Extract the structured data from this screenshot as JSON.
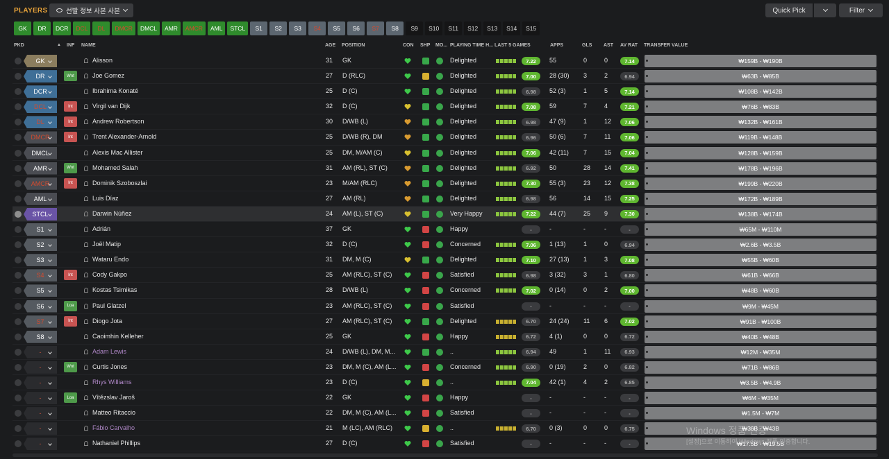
{
  "header": {
    "title": "PLAYERS",
    "view_label": "선발 정보 사본 사본",
    "quick_pick": "Quick Pick",
    "filter": "Filter"
  },
  "positions": [
    {
      "label": "GK",
      "style": "g"
    },
    {
      "label": "DR",
      "style": "g"
    },
    {
      "label": "DCR",
      "style": "g"
    },
    {
      "label": "DCL",
      "style": "r"
    },
    {
      "label": "DL",
      "style": "r"
    },
    {
      "label": "DMCR",
      "style": "r"
    },
    {
      "label": "DMCL",
      "style": "g"
    },
    {
      "label": "AMR",
      "style": "g"
    },
    {
      "label": "AMCR",
      "style": "r"
    },
    {
      "label": "AML",
      "style": "g"
    },
    {
      "label": "STCL",
      "style": "g"
    },
    {
      "label": "S1",
      "style": "b"
    },
    {
      "label": "S2",
      "style": "b"
    },
    {
      "label": "S3",
      "style": "b"
    },
    {
      "label": "S4",
      "style": "br"
    },
    {
      "label": "S5",
      "style": "b"
    },
    {
      "label": "S6",
      "style": "b"
    },
    {
      "label": "S7",
      "style": "br"
    },
    {
      "label": "S8",
      "style": "b"
    },
    {
      "label": "S9",
      "style": "d"
    },
    {
      "label": "S10",
      "style": "d"
    },
    {
      "label": "S11",
      "style": "d"
    },
    {
      "label": "S12",
      "style": "d"
    },
    {
      "label": "S13",
      "style": "d"
    },
    {
      "label": "S14",
      "style": "d"
    },
    {
      "label": "S15",
      "style": "d"
    }
  ],
  "columns": {
    "pkd": "PKD",
    "inf": "INF",
    "name": "NAME",
    "age": "AGE",
    "position": "POSITION",
    "con": "CON",
    "shp": "SHP",
    "mo": "MO...",
    "playing_time": "PLAYING TIME H...",
    "last5": "LAST 5 GAMES",
    "apps": "APPS",
    "gls": "GLS",
    "ast": "AST",
    "av_rat": "AV RAT",
    "transfer_value": "TRANSFER VALUE"
  },
  "players": [
    {
      "pkd": "GK",
      "tag": "gk",
      "red": false,
      "inf": "",
      "name": "Alisson",
      "loan": false,
      "age": "31",
      "position": "GK",
      "con": "g",
      "shp": "g",
      "pt": "Delighted",
      "l5": "ggggg",
      "last": "7.22",
      "lastg": true,
      "apps": "55",
      "gls": "0",
      "ast": "0",
      "av": "7.14",
      "avg": true,
      "tv": "₩159B - ₩190B",
      "checked": false
    },
    {
      "pkd": "DR",
      "tag": "df",
      "red": false,
      "inf": "Wnt",
      "name": "Joe Gomez",
      "loan": false,
      "age": "27",
      "position": "D (RLC)",
      "con": "g",
      "shp": "y",
      "pt": "Delighted",
      "l5": "ggggg",
      "last": "7.00",
      "lastg": true,
      "apps": "28 (30)",
      "gls": "3",
      "ast": "2",
      "av": "6.94",
      "avg": false,
      "tv": "₩63B - ₩85B",
      "checked": false
    },
    {
      "pkd": "DCR",
      "tag": "df",
      "red": false,
      "inf": "",
      "name": "Ibrahima Konaté",
      "loan": false,
      "age": "25",
      "position": "D (C)",
      "con": "g",
      "shp": "g",
      "pt": "Delighted",
      "l5": "ggggg",
      "last": "6.98",
      "lastg": false,
      "apps": "52 (3)",
      "gls": "1",
      "ast": "5",
      "av": "7.14",
      "avg": true,
      "tv": "₩108B - ₩142B",
      "checked": false
    },
    {
      "pkd": "DCL",
      "tag": "df",
      "red": true,
      "inf": "Int",
      "name": "Virgil van Dijk",
      "loan": false,
      "age": "32",
      "position": "D (C)",
      "con": "y",
      "shp": "g",
      "pt": "Delighted",
      "l5": "ggggg",
      "last": "7.08",
      "lastg": true,
      "apps": "59",
      "gls": "7",
      "ast": "4",
      "av": "7.21",
      "avg": true,
      "tv": "₩76B - ₩83B",
      "checked": false
    },
    {
      "pkd": "DL",
      "tag": "df",
      "red": true,
      "inf": "Int",
      "name": "Andrew Robertson",
      "loan": false,
      "age": "30",
      "position": "D/WB (L)",
      "con": "o",
      "shp": "g",
      "pt": "Delighted",
      "l5": "ggggg",
      "last": "6.98",
      "lastg": false,
      "apps": "47 (9)",
      "gls": "1",
      "ast": "12",
      "av": "7.06",
      "avg": true,
      "tv": "₩132B - ₩161B",
      "checked": false
    },
    {
      "pkd": "DMCR",
      "tag": "mf",
      "red": true,
      "inf": "Int",
      "name": "Trent Alexander-Arnold",
      "loan": false,
      "age": "25",
      "position": "D/WB (R), DM",
      "con": "o",
      "shp": "g",
      "pt": "Delighted",
      "l5": "ggggg",
      "last": "6.96",
      "lastg": false,
      "apps": "50 (6)",
      "gls": "7",
      "ast": "11",
      "av": "7.06",
      "avg": true,
      "tv": "₩119B - ₩148B",
      "checked": false
    },
    {
      "pkd": "DMCL",
      "tag": "mf",
      "red": false,
      "inf": "",
      "name": "Alexis Mac Allister",
      "loan": false,
      "age": "25",
      "position": "DM, M/AM (C)",
      "con": "y",
      "shp": "g",
      "pt": "Delighted",
      "l5": "ggggg",
      "last": "7.06",
      "lastg": true,
      "apps": "42 (11)",
      "gls": "7",
      "ast": "15",
      "av": "7.04",
      "avg": true,
      "tv": "₩128B - ₩159B",
      "checked": false
    },
    {
      "pkd": "AMR",
      "tag": "mf",
      "red": false,
      "inf": "Wnt",
      "name": "Mohamed Salah",
      "loan": false,
      "age": "31",
      "position": "AM (RL), ST (C)",
      "con": "o",
      "shp": "g",
      "pt": "Delighted",
      "l5": "ggggg",
      "last": "6.92",
      "lastg": false,
      "apps": "50",
      "gls": "28",
      "ast": "14",
      "av": "7.41",
      "avg": true,
      "tv": "₩178B - ₩196B",
      "checked": false
    },
    {
      "pkd": "AMCR",
      "tag": "mf",
      "red": true,
      "inf": "Int",
      "name": "Dominik Szoboszlai",
      "loan": false,
      "age": "23",
      "position": "M/AM (RLC)",
      "con": "o",
      "shp": "g",
      "pt": "Delighted",
      "l5": "ggggg",
      "last": "7.30",
      "lastg": true,
      "apps": "55 (3)",
      "gls": "23",
      "ast": "12",
      "av": "7.38",
      "avg": true,
      "tv": "₩199B - ₩220B",
      "checked": false
    },
    {
      "pkd": "AML",
      "tag": "mf",
      "red": false,
      "inf": "",
      "name": "Luis Díaz",
      "loan": false,
      "age": "27",
      "position": "AM (RL)",
      "con": "o",
      "shp": "g",
      "pt": "Delighted",
      "l5": "ggggg",
      "last": "6.98",
      "lastg": false,
      "apps": "56",
      "gls": "14",
      "ast": "15",
      "av": "7.25",
      "avg": true,
      "tv": "₩172B - ₩189B",
      "checked": false
    },
    {
      "pkd": "STCL",
      "tag": "st",
      "red": false,
      "inf": "",
      "name": "Darwin Núñez",
      "loan": false,
      "age": "24",
      "position": "AM (L), ST (C)",
      "con": "y",
      "shp": "g",
      "pt": "Very Happy",
      "l5": "ggggg",
      "last": "7.22",
      "lastg": true,
      "apps": "44 (7)",
      "gls": "25",
      "ast": "9",
      "av": "7.30",
      "avg": true,
      "tv": "₩138B - ₩174B",
      "checked": true
    },
    {
      "pkd": "S1",
      "tag": "sub",
      "red": false,
      "inf": "",
      "name": "Adrián",
      "loan": false,
      "age": "37",
      "position": "GK",
      "con": "g",
      "shp": "r",
      "pt": "Happy",
      "l5": "",
      "last": "-",
      "lastg": false,
      "apps": "-",
      "gls": "-",
      "ast": "-",
      "av": "-",
      "avg": false,
      "tv": "₩65M - ₩110M",
      "checked": false
    },
    {
      "pkd": "S2",
      "tag": "sub",
      "red": false,
      "inf": "",
      "name": "Joël Matip",
      "loan": false,
      "age": "32",
      "position": "D (C)",
      "con": "g",
      "shp": "r",
      "pt": "Concerned",
      "l5": "ggggg",
      "last": "7.06",
      "lastg": true,
      "apps": "1 (13)",
      "gls": "1",
      "ast": "0",
      "av": "6.94",
      "avg": false,
      "tv": "₩2.6B - ₩3.5B",
      "checked": false
    },
    {
      "pkd": "S3",
      "tag": "sub",
      "red": false,
      "inf": "",
      "name": "Wataru Endo",
      "loan": false,
      "age": "31",
      "position": "DM, M (C)",
      "con": "y",
      "shp": "g",
      "pt": "Delighted",
      "l5": "ggggg",
      "last": "7.10",
      "lastg": true,
      "apps": "27 (13)",
      "gls": "1",
      "ast": "3",
      "av": "7.08",
      "avg": true,
      "tv": "₩55B - ₩60B",
      "checked": false
    },
    {
      "pkd": "S4",
      "tag": "sub",
      "red": true,
      "inf": "Int",
      "name": "Cody Gakpo",
      "loan": false,
      "age": "25",
      "position": "AM (RLC), ST (C)",
      "con": "g",
      "shp": "r",
      "pt": "Satisfied",
      "l5": "ggggg",
      "last": "6.98",
      "lastg": false,
      "apps": "3 (32)",
      "gls": "3",
      "ast": "1",
      "av": "6.80",
      "avg": false,
      "tv": "₩61B - ₩66B",
      "checked": false
    },
    {
      "pkd": "S5",
      "tag": "sub",
      "red": false,
      "inf": "",
      "name": "Kostas Tsimikas",
      "loan": false,
      "age": "28",
      "position": "D/WB (L)",
      "con": "g",
      "shp": "r",
      "pt": "Concerned",
      "l5": "ggggg",
      "last": "7.02",
      "lastg": true,
      "apps": "0 (14)",
      "gls": "0",
      "ast": "2",
      "av": "7.00",
      "avg": true,
      "tv": "₩48B - ₩60B",
      "checked": false
    },
    {
      "pkd": "S6",
      "tag": "sub",
      "red": false,
      "inf": "Loa",
      "name": "Paul Glatzel",
      "loan": false,
      "age": "23",
      "position": "AM (RLC), ST (C)",
      "con": "g",
      "shp": "r",
      "pt": "Satisfied",
      "l5": "",
      "last": "-",
      "lastg": false,
      "apps": "-",
      "gls": "-",
      "ast": "-",
      "av": "-",
      "avg": false,
      "tv": "₩9M - ₩45M",
      "checked": false
    },
    {
      "pkd": "S7",
      "tag": "sub",
      "red": true,
      "inf": "Int",
      "name": "Diogo Jota",
      "loan": false,
      "age": "27",
      "position": "AM (RLC), ST (C)",
      "con": "g",
      "shp": "g",
      "pt": "Delighted",
      "l5": "yyyyy",
      "last": "6.70",
      "lastg": false,
      "apps": "24 (24)",
      "gls": "11",
      "ast": "6",
      "av": "7.02",
      "avg": true,
      "tv": "₩91B - ₩100B",
      "checked": false
    },
    {
      "pkd": "S8",
      "tag": "sub",
      "red": false,
      "inf": "",
      "name": "Caoimhin Kelleher",
      "loan": false,
      "age": "25",
      "position": "GK",
      "con": "g",
      "shp": "r",
      "pt": "Happy",
      "l5": "yyyyy",
      "last": "6.72",
      "lastg": false,
      "apps": "4 (1)",
      "gls": "0",
      "ast": "0",
      "av": "6.72",
      "avg": false,
      "tv": "₩40B - ₩48B",
      "checked": false
    },
    {
      "pkd": "-",
      "tag": "none",
      "red": false,
      "inf": "",
      "name": "Adam Lewis",
      "loan": true,
      "age": "24",
      "position": "D/WB (L), DM, M...",
      "con": "g",
      "shp": "g",
      "pt": "..",
      "l5": "ggggg",
      "last": "6.94",
      "lastg": false,
      "apps": "49",
      "gls": "1",
      "ast": "11",
      "av": "6.93",
      "avg": false,
      "tv": "₩12M - ₩35M",
      "checked": false
    },
    {
      "pkd": "-",
      "tag": "none",
      "red": false,
      "inf": "Wnt",
      "name": "Curtis Jones",
      "loan": false,
      "age": "23",
      "position": "DM, M (C), AM (L...",
      "con": "g",
      "shp": "r",
      "pt": "Concerned",
      "l5": "ggggg",
      "last": "6.90",
      "lastg": false,
      "apps": "0 (19)",
      "gls": "2",
      "ast": "0",
      "av": "6.82",
      "avg": false,
      "tv": "₩71B - ₩86B",
      "checked": false
    },
    {
      "pkd": "-",
      "tag": "none",
      "red": false,
      "inf": "",
      "name": "Rhys Williams",
      "loan": true,
      "age": "23",
      "position": "D (C)",
      "con": "g",
      "shp": "y",
      "pt": "..",
      "l5": "ggggg",
      "last": "7.04",
      "lastg": true,
      "apps": "42 (1)",
      "gls": "4",
      "ast": "2",
      "av": "6.85",
      "avg": false,
      "tv": "₩3.5B - ₩4.9B",
      "checked": false
    },
    {
      "pkd": "-",
      "tag": "none",
      "red": false,
      "inf": "Loa",
      "name": "Vítězslav Jaroš",
      "loan": false,
      "age": "22",
      "position": "GK",
      "con": "g",
      "shp": "r",
      "pt": "Happy",
      "l5": "",
      "last": "-",
      "lastg": false,
      "apps": "-",
      "gls": "-",
      "ast": "-",
      "av": "-",
      "avg": false,
      "tv": "₩6M - ₩35M",
      "checked": false
    },
    {
      "pkd": "-",
      "tag": "none",
      "red": false,
      "inf": "",
      "name": "Matteo Ritaccio",
      "loan": false,
      "age": "22",
      "position": "DM, M (C), AM (L...",
      "con": "g",
      "shp": "r",
      "pt": "Satisfied",
      "l5": "",
      "last": "-",
      "lastg": false,
      "apps": "-",
      "gls": "-",
      "ast": "-",
      "av": "-",
      "avg": false,
      "tv": "₩1.5M - ₩7M",
      "checked": false
    },
    {
      "pkd": "-",
      "tag": "none",
      "red": false,
      "inf": "",
      "name": "Fábio Carvalho",
      "loan": true,
      "age": "21",
      "position": "M (LC), AM (RLC)",
      "con": "g",
      "shp": "y",
      "pt": "..",
      "l5": "yyyyy",
      "last": "6.70",
      "lastg": false,
      "apps": "0 (3)",
      "gls": "0",
      "ast": "0",
      "av": "6.75",
      "avg": false,
      "tv": "₩36B - ₩43B",
      "checked": false
    },
    {
      "pkd": "-",
      "tag": "none",
      "red": false,
      "inf": "",
      "name": "Nathaniel Phillips",
      "loan": false,
      "age": "27",
      "position": "D (C)",
      "con": "g",
      "shp": "r",
      "pt": "Satisfied",
      "l5": "",
      "last": "-",
      "lastg": false,
      "apps": "-",
      "gls": "-",
      "ast": "-",
      "av": "-",
      "avg": false,
      "tv": "₩17.5B - ₩19.5B",
      "checked": false
    }
  ],
  "watermark": {
    "line1": "Windows 정품 인증",
    "line2": "[설정]으로 이동하여 Windows 정품 인증합니다."
  }
}
